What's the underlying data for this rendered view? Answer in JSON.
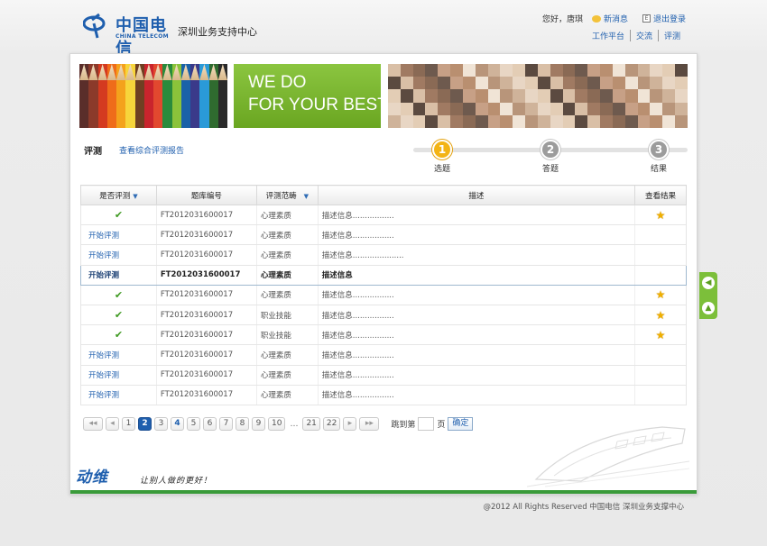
{
  "header": {
    "logo_cn": "中国电信",
    "logo_en": "CHINA TELECOM",
    "site_title": "深圳业务支持中心",
    "greeting": "您好，唐琪",
    "new_message": "新消息",
    "logout": "退出登录",
    "nav": [
      "工作平台",
      "交流",
      "评测"
    ]
  },
  "banner": {
    "line1": "WE DO",
    "line2": "FOR YOUR BEST",
    "pencil_colors": [
      "#5a2e2a",
      "#8b3a2a",
      "#d43a20",
      "#ef6c1a",
      "#f4a21c",
      "#f7d53b",
      "#6f3f22",
      "#c9242d",
      "#e2482f",
      "#2a8b3c",
      "#8bc33a",
      "#1a62a8",
      "#3a3a8a",
      "#2a9ad8",
      "#2f6b2f",
      "#2a2a2a"
    ]
  },
  "tabs": {
    "current": "评测",
    "report_link": "查看综合评测报告"
  },
  "steps": [
    {
      "num": "1",
      "label": "选题"
    },
    {
      "num": "2",
      "label": "答题"
    },
    {
      "num": "3",
      "label": "结果"
    }
  ],
  "table": {
    "headers": {
      "status": "是否评测",
      "code": "题库编号",
      "scope": "评测范畴",
      "desc": "描述",
      "result": "查看结果"
    },
    "rows": [
      {
        "status": "done",
        "code": "FT2012031600017",
        "scope": "心理素质",
        "desc": "描述信息.................",
        "star": true
      },
      {
        "status": "开始评测",
        "code": "FT2012031600017",
        "scope": "心理素质",
        "desc": "描述信息.................",
        "star": false
      },
      {
        "status": "开始评测",
        "code": "FT2012031600017",
        "scope": "心理素质",
        "desc": "描述信息.....................",
        "star": false
      },
      {
        "status": "开始评测",
        "code": "FT2012031600017",
        "scope": "心理素质",
        "desc": "描述信息",
        "star": false,
        "highlight": true
      },
      {
        "status": "done",
        "code": "FT2012031600017",
        "scope": "心理素质",
        "desc": "描述信息.................",
        "star": true
      },
      {
        "status": "done",
        "code": "FT2012031600017",
        "scope": "职业技能",
        "desc": "描述信息.................",
        "star": true
      },
      {
        "status": "done",
        "code": "FT2012031600017",
        "scope": "职业技能",
        "desc": "描述信息.................",
        "star": true
      },
      {
        "status": "开始评测",
        "code": "FT2012031600017",
        "scope": "心理素质",
        "desc": "描述信息.................",
        "star": false
      },
      {
        "status": "开始评测",
        "code": "FT2012031600017",
        "scope": "心理素质",
        "desc": "描述信息.................",
        "star": false
      },
      {
        "status": "开始评测",
        "code": "FT2012031600017",
        "scope": "心理素质",
        "desc": "描述信息.................",
        "star": false
      }
    ]
  },
  "pager": {
    "first": "◂◂",
    "prev": "◂",
    "pages": [
      "1",
      "2",
      "3",
      "4",
      "5",
      "6",
      "7",
      "8",
      "9",
      "10"
    ],
    "current": "2",
    "emphasized": "4",
    "ellipsis": "…",
    "tail_pages": [
      "21",
      "22"
    ],
    "next": "▸",
    "last": "▸▸",
    "jump_label": "跳到第",
    "page_unit": "页",
    "confirm": "确定"
  },
  "slogan": {
    "logo": "动维",
    "text": "让别人做的更好！"
  },
  "footer": "@2012 All Rights Reserved 中国电信 深圳业务支撑中心",
  "colors": {
    "brand_blue": "#1f5fae",
    "banner_green": "#7cb935",
    "step_active": "#f3b415",
    "step_inactive": "#9c9c9c",
    "bottom_bar": "#3a9b3a"
  },
  "icons": {
    "check": "check-icon",
    "star": "star-icon",
    "message": "message-icon",
    "exit": "exit-icon",
    "back": "arrow-left-icon",
    "top": "arrow-up-icon"
  }
}
